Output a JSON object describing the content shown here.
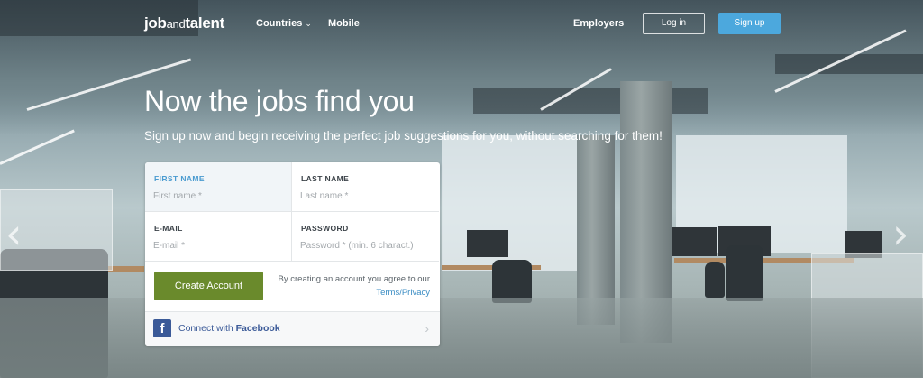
{
  "header": {
    "logo_bold_1": "job",
    "logo_light": "and",
    "logo_bold_2": "talent",
    "nav": {
      "countries": "Countries",
      "mobile": "Mobile",
      "employers": "Employers"
    },
    "login_label": "Log in",
    "signup_label": "Sign up"
  },
  "hero": {
    "title": "Now the jobs find you",
    "subtitle": "Sign up now and begin receiving the perfect job suggestions for you, without searching for them!"
  },
  "form": {
    "first_name": {
      "label": "FIRST NAME",
      "placeholder": "First name *"
    },
    "last_name": {
      "label": "LAST NAME",
      "placeholder": "Last name *"
    },
    "email": {
      "label": "E-MAIL",
      "placeholder": "E-mail *"
    },
    "password": {
      "label": "PASSWORD",
      "placeholder": "Password * (min. 6 charact.)"
    },
    "create_button": "Create Account",
    "terms_text": "By creating an account you agree to our",
    "terms_link": "Terms/Privacy",
    "facebook_prefix": "Connect with",
    "facebook_name": "Facebook",
    "facebook_icon_glyph": "f"
  },
  "icons": {
    "chevron_down": "chevron-down-icon",
    "arrow_left": "‹",
    "arrow_right": "›",
    "fb_chevron": "›"
  },
  "colors": {
    "signup_blue": "#4ca8dd",
    "create_green": "#6a8a2c",
    "facebook_blue": "#3b5a98",
    "active_label_blue": "#4a9bd0"
  }
}
